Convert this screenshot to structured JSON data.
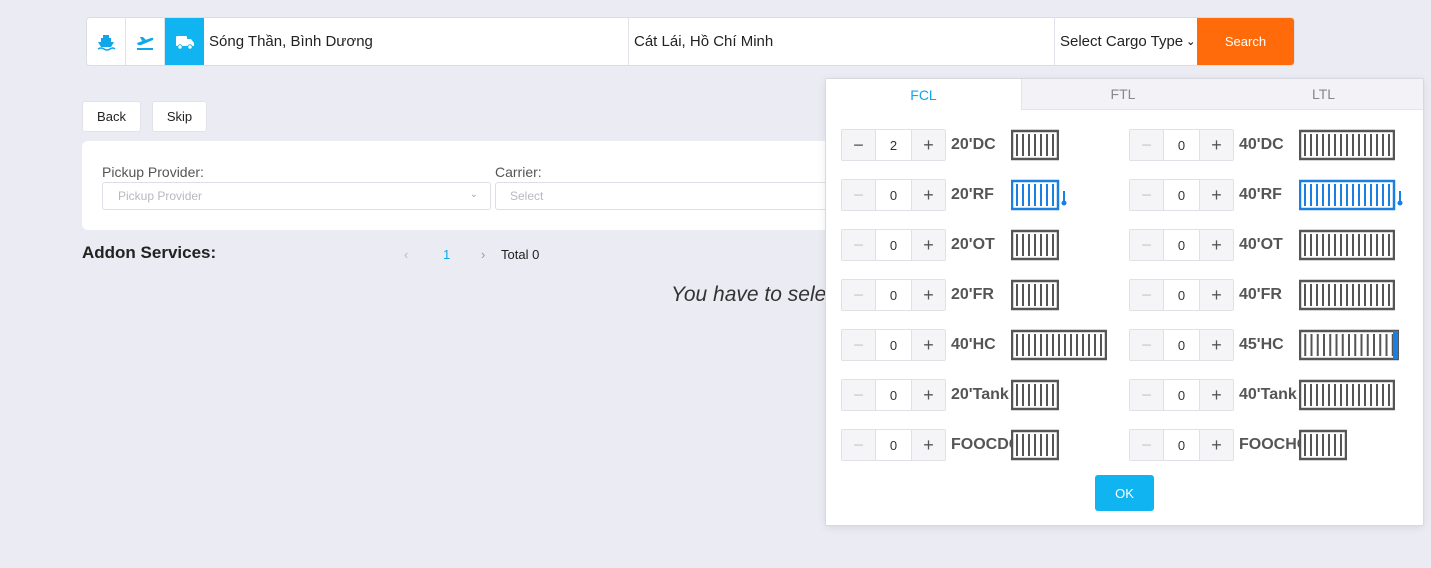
{
  "search": {
    "modes": [
      {
        "name": "ship-icon",
        "active": false
      },
      {
        "name": "plane-icon",
        "active": false
      },
      {
        "name": "truck-icon",
        "active": true
      }
    ],
    "from": "Sóng Thần, Bình Dương",
    "to": "Cát Lái, Hồ Chí Minh",
    "cargo_type": "Select Cargo Type",
    "search_label": "Search"
  },
  "actions": {
    "back": "Back",
    "skip": "Skip"
  },
  "provider": {
    "pickup_label": "Pickup Provider:",
    "pickup_placeholder": "Pickup Provider",
    "carrier_label": "Carrier:",
    "carrier_placeholder": "Select"
  },
  "addon": {
    "title": "Addon Services:",
    "page": "1",
    "total": "Total 0",
    "empty_message": "You have to sele"
  },
  "panel": {
    "tabs": [
      "FCL",
      "FTL",
      "LTL"
    ],
    "active_tab": "FCL",
    "containers_left": [
      {
        "type": "20'DC",
        "qty": "2",
        "icon": "container-icon",
        "reefer": false
      },
      {
        "type": "20'RF",
        "qty": "0",
        "icon": "reefer-container-icon",
        "reefer": true
      },
      {
        "type": "20'OT",
        "qty": "0",
        "icon": "container-icon",
        "reefer": false
      },
      {
        "type": "20'FR",
        "qty": "0",
        "icon": "container-icon",
        "reefer": false
      },
      {
        "type": "40'HC",
        "qty": "0",
        "icon": "container-icon",
        "reefer": false
      },
      {
        "type": "20'Tank",
        "qty": "0",
        "icon": "container-icon",
        "reefer": false
      },
      {
        "type": "FOOCDC",
        "qty": "0",
        "icon": "container-icon",
        "reefer": false
      }
    ],
    "containers_right": [
      {
        "type": "40'DC",
        "qty": "0",
        "icon": "container-icon",
        "reefer": false
      },
      {
        "type": "40'RF",
        "qty": "0",
        "icon": "reefer-container-icon",
        "reefer": true
      },
      {
        "type": "40'OT",
        "qty": "0",
        "icon": "container-icon",
        "reefer": false
      },
      {
        "type": "40'FR",
        "qty": "0",
        "icon": "container-icon",
        "reefer": false
      },
      {
        "type": "45'HC",
        "qty": "0",
        "icon": "container-icon",
        "reefer": false
      },
      {
        "type": "40'Tank",
        "qty": "0",
        "icon": "container-icon",
        "reefer": false
      },
      {
        "type": "FOOCHC",
        "qty": "0",
        "icon": "container-icon",
        "reefer": false
      }
    ],
    "ok_label": "OK"
  },
  "colors": {
    "accent": "#10b4f0",
    "search": "#ff6a0a",
    "container": "#555555",
    "reefer": "#1a7fe0"
  }
}
